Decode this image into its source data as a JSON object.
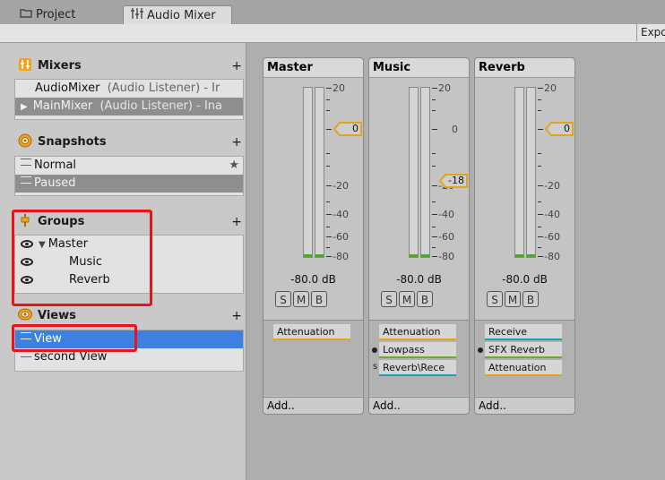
{
  "tabs": {
    "project_label": "Project",
    "audio_mixer_label": "Audio Mixer"
  },
  "toolbar": {
    "export_label": "Expo"
  },
  "mixers": {
    "title": "Mixers",
    "add": "+",
    "items": [
      {
        "name": "AudioMixer",
        "detail": "(Audio Listener) - Ir"
      },
      {
        "name": "MainMixer",
        "detail": "(Audio Listener) - Ina"
      }
    ]
  },
  "snapshots": {
    "title": "Snapshots",
    "add": "+",
    "star": "★",
    "items": [
      {
        "name": "Normal"
      },
      {
        "name": "Paused"
      }
    ]
  },
  "groups": {
    "title": "Groups",
    "add": "+",
    "items": [
      {
        "name": "Master"
      },
      {
        "name": "Music"
      },
      {
        "name": "Reverb"
      }
    ]
  },
  "views": {
    "title": "Views",
    "add": "+",
    "items": [
      {
        "name": "View"
      },
      {
        "name": "second View"
      }
    ]
  },
  "strips": [
    {
      "name": "Master",
      "level_db": "-80.0 dB",
      "fader": "0",
      "s": "S",
      "m": "M",
      "b": "B",
      "effects": [
        "Attenuation"
      ],
      "add": "Add.."
    },
    {
      "name": "Music",
      "level_db": "-80.0 dB",
      "fader": "-18",
      "s": "S",
      "m": "M",
      "b": "B",
      "effects": [
        "Attenuation",
        "Lowpass",
        "Reverb\\Rece"
      ],
      "send_marker": "s",
      "add": "Add.."
    },
    {
      "name": "Reverb",
      "level_db": "-80.0 dB",
      "fader": "0",
      "s": "S",
      "m": "M",
      "b": "B",
      "effects": [
        "Receive",
        "SFX Reverb",
        "Attenuation"
      ],
      "add": "Add.."
    }
  ],
  "scale_labels": [
    "20",
    "0",
    "-20",
    "-40",
    "-60",
    "-80"
  ],
  "colors": {
    "accent_blue": "#3d80df",
    "highlight_red": "#e8141a",
    "fader_orange": "#e3a41d",
    "meter_green": "#4aa42e"
  }
}
